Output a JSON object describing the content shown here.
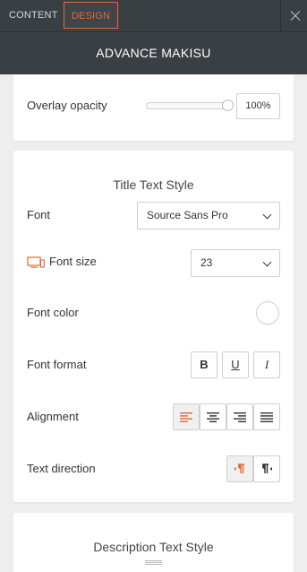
{
  "tabs": {
    "content": "CONTENT",
    "design": "DESIGN"
  },
  "header": {
    "title": "ADVANCE MAKISU"
  },
  "overlay": {
    "label": "Overlay opacity",
    "value": "100%",
    "slider_level": 100
  },
  "title_style": {
    "heading": "Title Text Style",
    "font_label": "Font",
    "font_value": "Source Sans Pro",
    "font_size_label": "Font size",
    "font_size_value": "23",
    "font_color_label": "Font color",
    "font_color_value": "#ffffff",
    "font_format_label": "Font format",
    "format_buttons": {
      "bold": "B",
      "underline": "U",
      "italic": "I"
    },
    "alignment_label": "Alignment",
    "alignment_selected": "left",
    "text_direction_label": "Text direction",
    "text_direction_selected": "ltr"
  },
  "description_style": {
    "heading": "Description Text Style"
  },
  "colors": {
    "accent": "#e4683a",
    "header_bg": "#3a3f44"
  }
}
